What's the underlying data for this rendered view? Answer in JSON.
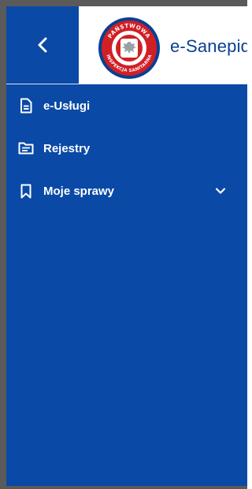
{
  "header": {
    "back_icon": "chevron-left-icon",
    "logo_ring_text_top": "PAŃSTWOWA",
    "logo_ring_text_bottom": "INSPEKCJA SANITARNA",
    "brand_name": "e-Sanepid",
    "colors": {
      "primary": "#0a49a6",
      "logo_ring": "#d11f26",
      "logo_inner": "#0a3f92"
    }
  },
  "nav": {
    "items": [
      {
        "label": "e-Usługi",
        "icon": "document-icon"
      },
      {
        "label": "Rejestry",
        "icon": "folder-list-icon"
      },
      {
        "label": "Moje sprawy",
        "icon": "bookmark-icon",
        "expandable": true,
        "expand_icon": "chevron-down-icon"
      }
    ]
  }
}
